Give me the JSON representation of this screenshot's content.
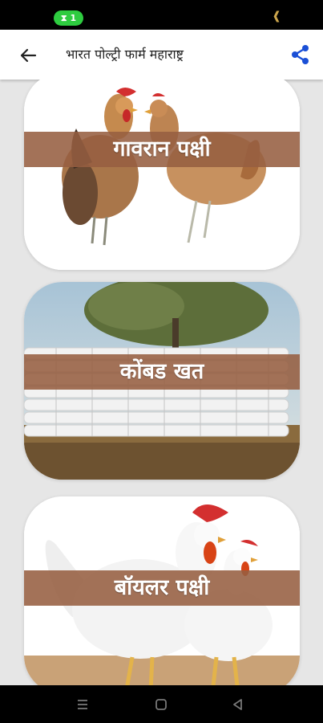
{
  "status_bar": {
    "badge": "1",
    "right_glyph": "❰"
  },
  "app_bar": {
    "title": "भारत पोल्ट्री फार्म महाराष्ट्र",
    "back_icon": "arrow-left-icon",
    "share_icon": "share-icon",
    "accent": "#1a4fd6"
  },
  "cards": [
    {
      "label": "गावरान पक्षी",
      "image": "country-hens"
    },
    {
      "label": "कोंबड खत",
      "image": "manure-sacks"
    },
    {
      "label": "बॉयलर पक्षी",
      "image": "white-broilers"
    }
  ],
  "nav_bar": {
    "items": [
      "menu-icon",
      "home-square-icon",
      "back-triangle-icon"
    ]
  },
  "colors": {
    "label_band": "#965f41",
    "background": "#e6e6e6"
  }
}
